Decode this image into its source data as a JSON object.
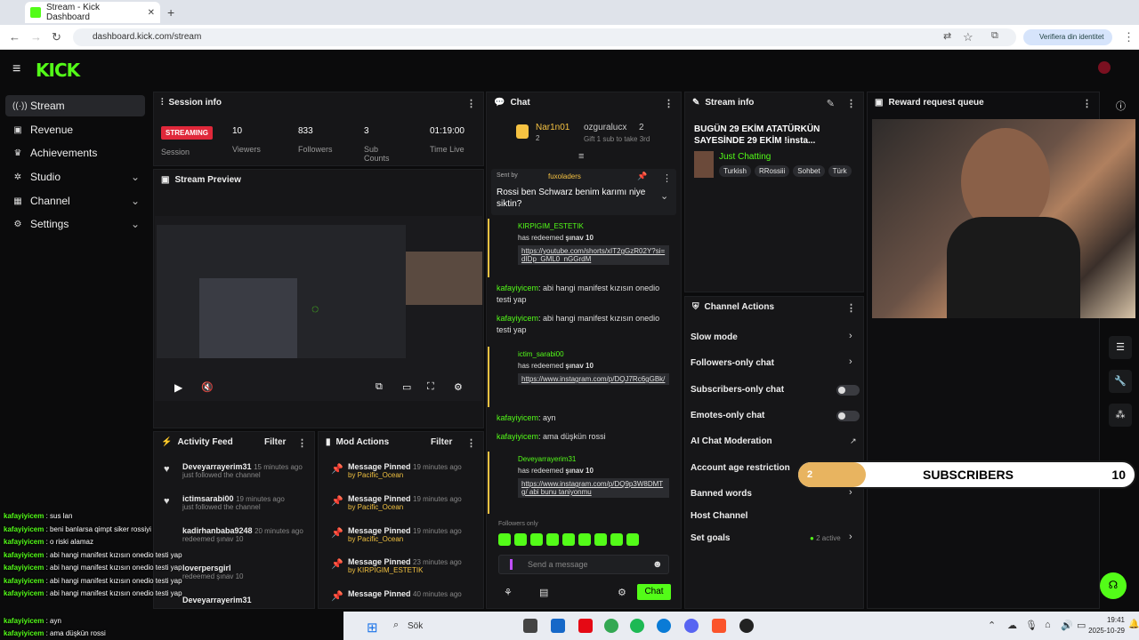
{
  "browser": {
    "tab_title": "Stream - Kick Dashboard",
    "url": "dashboard.kick.com/stream",
    "verify_label": "Verifiera din identitet"
  },
  "brand": {
    "logo": "KICK",
    "accent": "#53fc18",
    "live_red": "#e0283a"
  },
  "sidebar": {
    "items": [
      {
        "label": "Stream",
        "icon": "broadcast-icon"
      },
      {
        "label": "Revenue",
        "icon": "wallet-icon"
      },
      {
        "label": "Achievements",
        "icon": "trophy-icon"
      },
      {
        "label": "Studio",
        "icon": "settings-icon"
      },
      {
        "label": "Channel",
        "icon": "channel-icon"
      },
      {
        "label": "Settings",
        "icon": "gear-icon"
      }
    ]
  },
  "session": {
    "title": "Session info",
    "status": "STREAMING",
    "status_label": "Session",
    "stats": [
      {
        "value": "10",
        "label": "Viewers"
      },
      {
        "value": "833",
        "label": "Followers"
      },
      {
        "value": "3",
        "label": "Sub Counts"
      },
      {
        "value": "01:19:00",
        "label": "Time Live"
      }
    ]
  },
  "preview": {
    "title": "Stream Preview"
  },
  "activity": {
    "title": "Activity Feed",
    "filter": "Filter",
    "rows": [
      {
        "name": "Deveyarrayerim31",
        "time": "15 minutes ago",
        "text": "just followed the channel"
      },
      {
        "name": "ictimsarabi00",
        "time": "19 minutes ago",
        "text": "just followed the channel"
      },
      {
        "name": "kadirhanbaba9248",
        "time": "20 minutes ago",
        "text": "redeemed şınav 10"
      },
      {
        "name": "loverpersgirl",
        "time": "",
        "text": "redeemed şınav 10"
      },
      {
        "name": "Deveyarrayerim31",
        "time": "",
        "text": ""
      }
    ]
  },
  "mod": {
    "title": "Mod Actions",
    "filter": "Filter",
    "rows": [
      {
        "name": "Message Pinned",
        "time": "19 minutes ago",
        "by": "by Pacific_Ocean"
      },
      {
        "name": "Message Pinned",
        "time": "19 minutes ago",
        "by": "by Pacific_Ocean"
      },
      {
        "name": "Message Pinned",
        "time": "19 minutes ago",
        "by": "by Pacific_Ocean"
      },
      {
        "name": "Message Pinned",
        "time": "23 minutes ago",
        "by": "by KIRPIGIM_ESTETIK"
      },
      {
        "name": "Message Pinned",
        "time": "40 minutes ago",
        "by": ""
      }
    ]
  },
  "chat": {
    "title": "Chat",
    "top_users": [
      {
        "name": "Nar1n01",
        "count": "2"
      },
      {
        "name": "ozguralucx",
        "count": "2"
      }
    ],
    "gift_text": "Gift 1 sub to take 3rd",
    "pinned_by": "Sent by",
    "pinned_user": "fuxoladers",
    "pinned_text": "Rossi ben Schwarz benim karımı niye siktin?",
    "messages": [
      {
        "type": "redeem",
        "user": "KIRPIGIM_ESTETIK",
        "reward": "şınav 10",
        "link": "https://youtube.com/shorts/xIT2gGzR02Y?si=dIDp_GML0_nGGrdM"
      },
      {
        "type": "text",
        "user": "kafayiyicem",
        "text": "abi hangi manifest kızısın onedio testi yap"
      },
      {
        "type": "text",
        "user": "kafayiyicem",
        "text": "abi hangi manifest kızısın onedio testi yap"
      },
      {
        "type": "redeem",
        "user": "ictim_sarabi00",
        "reward": "şınav 10",
        "link": "https://www.instagram.com/p/DQJ7Rc6gGBk/"
      },
      {
        "type": "text",
        "user": "kafayiyicem",
        "text": "ayn"
      },
      {
        "type": "text",
        "user": "kafayiyicem",
        "text": "ama düşkün rossi"
      },
      {
        "type": "redeem",
        "user": "Deveyarrayerim31",
        "reward": "şınav 10",
        "link": "https://www.instagram.com/p/DQ9p3W8DMTg/ abi bunu taniyonmu"
      }
    ],
    "followers_only": "Followers only",
    "placeholder": "Send a message",
    "send_label": "Chat"
  },
  "stream_info": {
    "title": "Stream info",
    "stream_title": "BUGÜN 29 EKİM ATATÜRKÜN SAYESİNDE 29 EKİM !insta...",
    "category": "Just Chatting",
    "tags": [
      "Turkish",
      "RRossiii",
      "Sohbet",
      "Türk"
    ]
  },
  "channel_actions": {
    "title": "Channel Actions",
    "items": [
      {
        "label": "Slow mode",
        "control": "chevron"
      },
      {
        "label": "Followers-only chat",
        "control": "chevron"
      },
      {
        "label": "Subscribers-only chat",
        "control": "toggle"
      },
      {
        "label": "Emotes-only chat",
        "control": "toggle"
      },
      {
        "label": "AI Chat Moderation",
        "control": "external"
      },
      {
        "label": "Account age restriction",
        "control": "chevron"
      },
      {
        "label": "Banned words",
        "control": "chevron"
      },
      {
        "label": "Host Channel",
        "control": "none"
      },
      {
        "label": "Set goals",
        "control": "chevron",
        "badge": "2 active"
      }
    ]
  },
  "reward_queue": {
    "title": "Reward request queue"
  },
  "sub_goal": {
    "current": "2",
    "label": "SUBSCRIBERS",
    "target": "10",
    "progress": 0.2
  },
  "overlay_chat": [
    {
      "user": "kafayiyicem",
      "text": "sus lan"
    },
    {
      "user": "kafayiyicem",
      "text": "beni banlarsa qimpt siker rossiyi"
    },
    {
      "user": "kafayiyicem",
      "text": "o riski alamaz"
    },
    {
      "user": "kafayiyicem",
      "text": "abi hangi manifest kızısın onedio testi yap"
    },
    {
      "user": "kafayiyicem",
      "text": "abi hangi manifest kızısın onedio testi yap"
    },
    {
      "user": "kafayiyicem",
      "text": "abi hangi manifest kızısın onedio testi yap"
    },
    {
      "user": "kafayiyicem",
      "text": "abi hangi manifest kızısın onedio testi yap"
    },
    {
      "user": "kafayiyicem",
      "text": "ayn"
    },
    {
      "user": "kafayiyicem",
      "text": "ama düşkün rossi"
    }
  ],
  "taskbar": {
    "search": "Sök",
    "time": "19:41",
    "date": "2025-10-29"
  }
}
